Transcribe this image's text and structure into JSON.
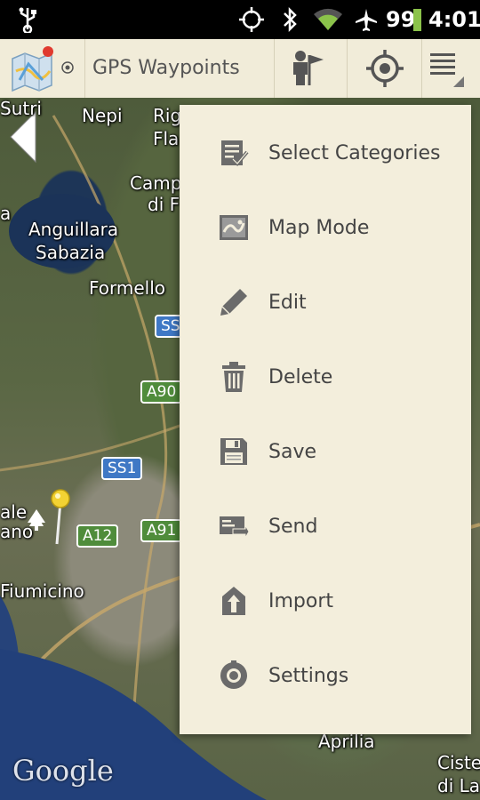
{
  "status_bar": {
    "battery_percent": "99",
    "time": "4:01",
    "icons": [
      "usb-icon",
      "gps-icon",
      "bluetooth-icon",
      "wifi-icon",
      "airplane-icon",
      "battery-icon"
    ]
  },
  "action_bar": {
    "title": "GPS Waypoints",
    "icons": [
      "map-app-icon",
      "dropdown-icon",
      "waypoint-person-icon",
      "gps-locate-icon",
      "overflow-menu-icon"
    ]
  },
  "map": {
    "labels": [
      "Sutri",
      "Nepi",
      "Rig",
      "Fla",
      "Camp",
      "di F",
      "Anguillara",
      "Sabazia",
      "Formello",
      "Fiumicino",
      "Aprilia",
      "Ciste",
      "di La",
      "ale",
      "ano",
      "a"
    ],
    "road_shields": [
      {
        "text": "SS",
        "color": "#3f78c5"
      },
      {
        "text": "A90",
        "color": "#4f8c3b"
      },
      {
        "text": "SS1",
        "color": "#3f78c5"
      },
      {
        "text": "A12",
        "color": "#4f8c3b"
      },
      {
        "text": "A91",
        "color": "#4f8c3b"
      }
    ],
    "attribution": "Google"
  },
  "menu": {
    "items": [
      {
        "label": "Select Categories",
        "icon": "select-categories-icon"
      },
      {
        "label": "Map Mode",
        "icon": "map-mode-icon"
      },
      {
        "label": "Edit",
        "icon": "edit-pencil-icon"
      },
      {
        "label": "Delete",
        "icon": "trash-icon"
      },
      {
        "label": "Save",
        "icon": "save-floppy-icon"
      },
      {
        "label": "Send",
        "icon": "send-icon"
      },
      {
        "label": "Import",
        "icon": "import-icon"
      },
      {
        "label": "Settings",
        "icon": "settings-gear-icon"
      }
    ]
  },
  "colors": {
    "action_bar_bg": "#f1ecd9",
    "menu_bg": "#f3eedc",
    "accent_red": "#e03a2f",
    "wifi_green": "#8bc34a"
  }
}
